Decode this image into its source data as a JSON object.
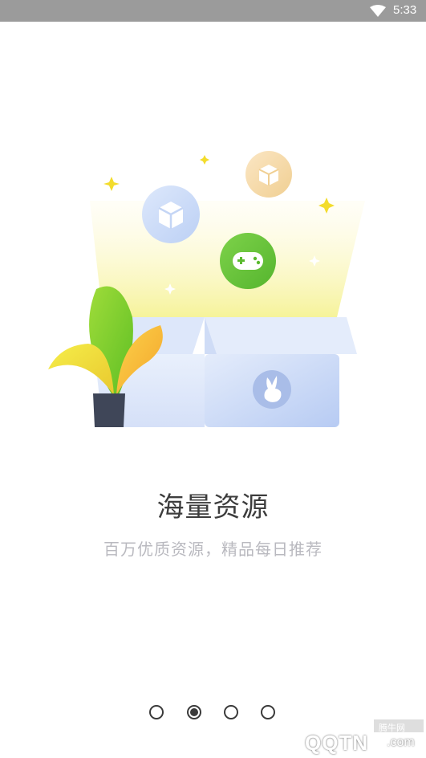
{
  "status_bar": {
    "time": "5:33",
    "wifi_icon": "wifi-icon"
  },
  "onboarding": {
    "title": "海量资源",
    "subtitle": "百万优质资源，精品每日推荐",
    "page_indicator": {
      "total": 4,
      "current": 2
    }
  },
  "illustration": {
    "icons": [
      "cube-icon",
      "box-icon",
      "gamepad-icon",
      "rabbit-logo-icon",
      "sparkle-icon",
      "plant-icon"
    ]
  },
  "watermark": {
    "site": "腾牛网",
    "brand": "QQTN",
    "suffix": ".com"
  },
  "colors": {
    "accent_green": "#6cc63a",
    "title_text": "#3d3d3d",
    "subtitle_text": "#b9b9bf",
    "status_bar": "#9b9b9b"
  }
}
